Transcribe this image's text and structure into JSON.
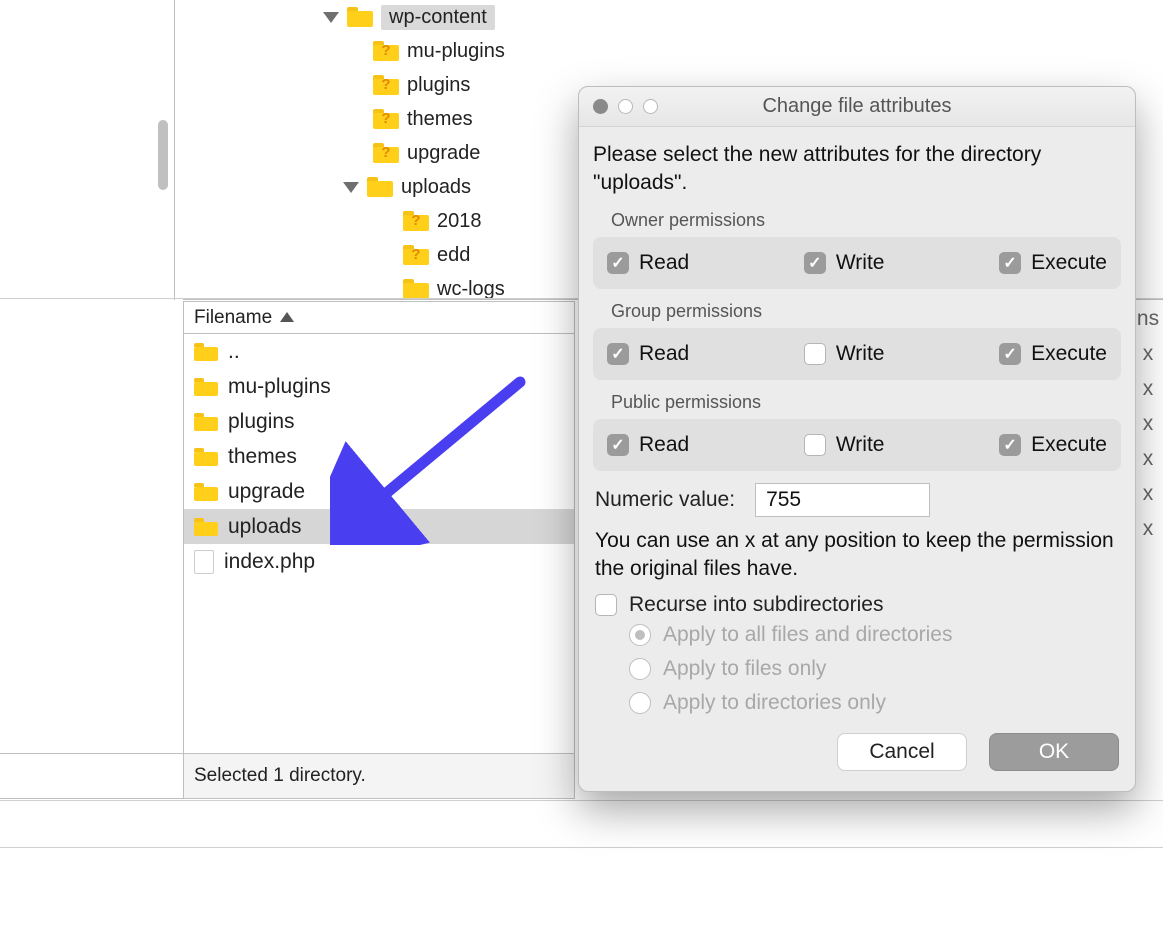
{
  "tree": {
    "root": "wp-content",
    "children": [
      {
        "name": "mu-plugins",
        "icon": "q"
      },
      {
        "name": "plugins",
        "icon": "q"
      },
      {
        "name": "themes",
        "icon": "q"
      },
      {
        "name": "upgrade",
        "icon": "q"
      },
      {
        "name": "uploads",
        "icon": "folder",
        "expanded": true,
        "children": [
          {
            "name": "2018",
            "icon": "q"
          },
          {
            "name": "edd",
            "icon": "q"
          },
          {
            "name": "wc-logs",
            "icon": "folder"
          }
        ]
      }
    ]
  },
  "files": {
    "header": "Filename",
    "rows": [
      {
        "name": "..",
        "type": "folder"
      },
      {
        "name": "mu-plugins",
        "type": "folder"
      },
      {
        "name": "plugins",
        "type": "folder"
      },
      {
        "name": "themes",
        "type": "folder"
      },
      {
        "name": "upgrade",
        "type": "folder"
      },
      {
        "name": "uploads",
        "type": "folder",
        "selected": true
      },
      {
        "name": "index.php",
        "type": "file"
      }
    ]
  },
  "right_col_hint": "ns",
  "right_col_rows": [
    "",
    "x",
    "x",
    "x",
    "x",
    "x",
    "x"
  ],
  "status": "Selected 1 directory.",
  "dialog": {
    "title": "Change file attributes",
    "intro": "Please select the new attributes for the directory \"uploads\".",
    "groups": [
      {
        "title": "Owner permissions",
        "read": true,
        "write": true,
        "execute": true
      },
      {
        "title": "Group permissions",
        "read": true,
        "write": false,
        "execute": true
      },
      {
        "title": "Public permissions",
        "read": true,
        "write": false,
        "execute": true
      }
    ],
    "perm_labels": {
      "read": "Read",
      "write": "Write",
      "execute": "Execute"
    },
    "numeric_label": "Numeric value:",
    "numeric_value": "755",
    "hint": "You can use an x at any position to keep the permission the original files have.",
    "recurse_label": "Recurse into subdirectories",
    "recurse_checked": false,
    "radios": [
      {
        "label": "Apply to all files and directories",
        "selected": true
      },
      {
        "label": "Apply to files only",
        "selected": false
      },
      {
        "label": "Apply to directories only",
        "selected": false
      }
    ],
    "buttons": {
      "cancel": "Cancel",
      "ok": "OK"
    }
  }
}
